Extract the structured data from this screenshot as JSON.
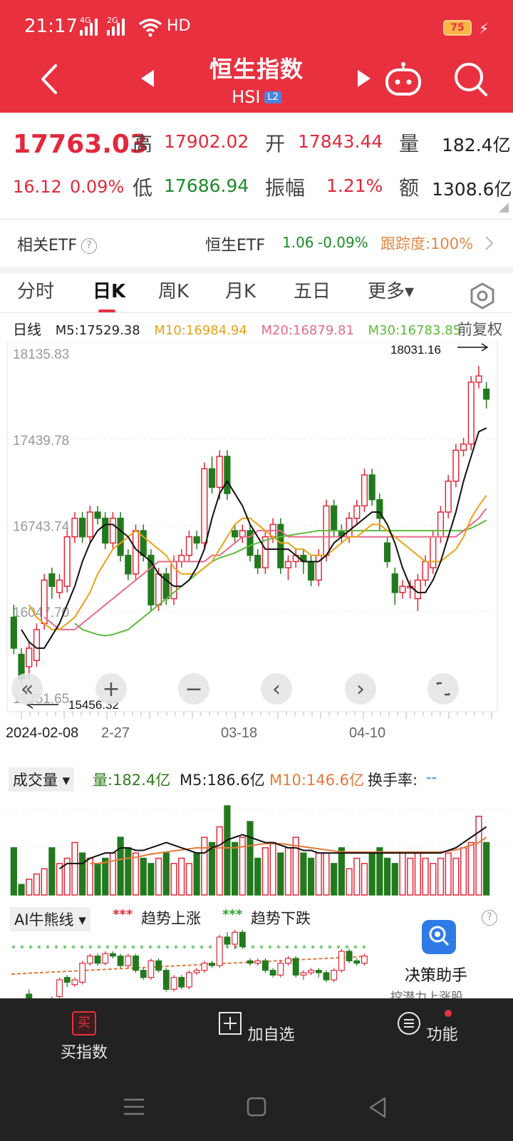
{
  "status": {
    "time": "21:17",
    "sig1": "4G",
    "sig2": "2G",
    "hd": "HD",
    "battery": "75"
  },
  "header": {
    "title": "恒生指数",
    "subtitle": "HSI",
    "badge": "L2"
  },
  "quote": {
    "price": "17763.03",
    "change": "16.12",
    "change_pct": "0.09%",
    "high_label": "高",
    "high": "17902.02",
    "low_label": "低",
    "low": "17686.94",
    "open_label": "开",
    "open": "17843.44",
    "amp_label": "振幅",
    "amp": "1.21%",
    "vol_label": "量",
    "vol": "182.4亿",
    "amt_label": "额",
    "amt": "1308.6亿"
  },
  "etf": {
    "label": "相关ETF",
    "name": "恒生ETF",
    "price": "1.06",
    "pct": "-0.09%",
    "track": "跟踪度:100%"
  },
  "tabs": [
    "分时",
    "日K",
    "周K",
    "月K",
    "五日",
    "更多▾"
  ],
  "ma": {
    "day": "日线",
    "m5": "M5:17529.38",
    "m10": "M10:16984.94",
    "m20": "M20:16879.81",
    "m30": "M30:16783.85",
    "adj": "前复权"
  },
  "volume_panel": {
    "label": "成交量",
    "vol": "量:182.4亿",
    "m5": "M5:186.6亿",
    "m10": "M10:146.6亿",
    "turnover": "换手率:",
    "turnover_val": "--"
  },
  "ai_panel": {
    "label": "AI牛熊线",
    "up": "趋势上涨",
    "down": "趋势下跌",
    "stars": "***"
  },
  "helper": {
    "title": "决策助手",
    "sub": "挖潜力上涨股"
  },
  "nav": {
    "buy": "买指数",
    "buy_icon": "买",
    "add": "加自选",
    "func": "功能"
  },
  "colors": {
    "up": "#e2283a",
    "down": "#237a1e",
    "m5": "#111111",
    "m10": "#e8a21a",
    "m20": "#e76a8a",
    "m30": "#5cbb3a"
  },
  "chart_data": {
    "type": "candlestick",
    "y_ticks": [
      "18135.83",
      "17439.78",
      "16743.74",
      "16047.70",
      "15351.65"
    ],
    "ylim": [
      15351.65,
      18135.83
    ],
    "x_ticks": [
      "2024-02-08",
      "2-27",
      "03-18",
      "04-10"
    ],
    "max_label": "18031.16",
    "min_label": "15456.32",
    "candles": [
      [
        16000,
        15750,
        16100,
        15700
      ],
      [
        15700,
        15500,
        15750,
        15456.32
      ],
      [
        15600,
        15750,
        15800,
        15500
      ],
      [
        15650,
        15900,
        15950,
        15600
      ],
      [
        15950,
        16300,
        16350,
        15900
      ],
      [
        16350,
        16250,
        16400,
        16150
      ],
      [
        16200,
        16300,
        16350,
        16150
      ],
      [
        16250,
        16650,
        16700,
        16200
      ],
      [
        16650,
        16800,
        16850,
        16600
      ],
      [
        16800,
        16650,
        16850,
        16600
      ],
      [
        16650,
        16850,
        16900,
        16600
      ],
      [
        16850,
        16800,
        16900,
        16750
      ],
      [
        16800,
        16600,
        16850,
        16550
      ],
      [
        16600,
        16800,
        16850,
        16550
      ],
      [
        16800,
        16500,
        16850,
        16450
      ],
      [
        16500,
        16350,
        16550,
        16300
      ],
      [
        16350,
        16700,
        16750,
        16300
      ],
      [
        16700,
        16500,
        16750,
        16450
      ],
      [
        16500,
        16100,
        16550,
        16050
      ],
      [
        16100,
        16350,
        16400,
        16050
      ],
      [
        16350,
        16150,
        16400,
        16100
      ],
      [
        16150,
        16450,
        16500,
        16100
      ],
      [
        16450,
        16500,
        16550,
        16400
      ],
      [
        16500,
        16650,
        16700,
        16450
      ],
      [
        16650,
        16600,
        16700,
        16550
      ],
      [
        16600,
        17200,
        17250,
        16550
      ],
      [
        17200,
        17050,
        17300,
        17000
      ],
      [
        17050,
        17300,
        17350,
        16950
      ],
      [
        17300,
        17000,
        17350,
        16950
      ],
      [
        16700,
        16650,
        16750,
        16600
      ],
      [
        16650,
        16700,
        16750,
        16600
      ],
      [
        16700,
        16500,
        16750,
        16450
      ],
      [
        16500,
        16400,
        16550,
        16350
      ],
      [
        16400,
        16650,
        16700,
        16350
      ],
      [
        16650,
        16750,
        16800,
        16600
      ],
      [
        16750,
        16400,
        16800,
        16350
      ],
      [
        16400,
        16450,
        16500,
        16300
      ],
      [
        16450,
        16500,
        16550,
        16400
      ],
      [
        16500,
        16450,
        16550,
        16350
      ],
      [
        16450,
        16300,
        16500,
        16250
      ],
      [
        16300,
        16500,
        16550,
        16250
      ],
      [
        16500,
        16900,
        16950,
        16450
      ],
      [
        16900,
        16700,
        16950,
        16650
      ],
      [
        16700,
        16650,
        16750,
        16600
      ],
      [
        16650,
        16800,
        16850,
        16600
      ],
      [
        16800,
        16900,
        16950,
        16750
      ],
      [
        16900,
        17150,
        17200,
        16850
      ],
      [
        17150,
        16950,
        17200,
        16900
      ],
      [
        16950,
        16800,
        17000,
        16700
      ],
      [
        16600,
        16450,
        16650,
        16400
      ],
      [
        16350,
        16200,
        16400,
        16100
      ],
      [
        16200,
        16250,
        16300,
        16150
      ],
      [
        16250,
        16250,
        16300,
        16150
      ],
      [
        16150,
        16300,
        16350,
        16050
      ],
      [
        16300,
        16450,
        16500,
        16250
      ],
      [
        16400,
        16650,
        16700,
        16350
      ],
      [
        16650,
        16850,
        16900,
        16600
      ],
      [
        16850,
        17100,
        17150,
        16800
      ],
      [
        17100,
        17350,
        17400,
        17050
      ],
      [
        17350,
        17400,
        17450,
        17300
      ],
      [
        17400,
        17900,
        17950,
        17350
      ],
      [
        17900,
        17950,
        18031.16,
        17850
      ],
      [
        17843.44,
        17763.03,
        17902.02,
        17686.94
      ]
    ],
    "ma": {
      "m5": [
        15900,
        15800,
        15750,
        15750,
        15850,
        15950,
        16100,
        16250,
        16450,
        16600,
        16700,
        16750,
        16750,
        16700,
        16650,
        16550,
        16500,
        16450,
        16350,
        16300,
        16250,
        16250,
        16300,
        16400,
        16550,
        16800,
        17000,
        17100,
        17000,
        16900,
        16750,
        16650,
        16550,
        16550,
        16550,
        16550,
        16500,
        16450,
        16450,
        16450,
        16500,
        16600,
        16650,
        16700,
        16750,
        16800,
        16850,
        16850,
        16750,
        16600,
        16400,
        16250,
        16200,
        16200,
        16300,
        16450,
        16650,
        16850,
        17100,
        17300,
        17500,
        17529.38
      ],
      "m10": [
        16100,
        16000,
        15950,
        15900,
        15900,
        15950,
        16000,
        16100,
        16200,
        16350,
        16450,
        16550,
        16600,
        16650,
        16700,
        16650,
        16600,
        16550,
        16500,
        16400,
        16350,
        16350,
        16350,
        16400,
        16450,
        16550,
        16650,
        16750,
        16800,
        16800,
        16750,
        16700,
        16650,
        16600,
        16600,
        16550,
        16550,
        16500,
        16500,
        16500,
        16550,
        16600,
        16650,
        16650,
        16700,
        16750,
        16750,
        16700,
        16650,
        16600,
        16550,
        16500,
        16450,
        16450,
        16450,
        16500,
        16550,
        16650,
        16800,
        16900,
        16984.94
      ],
      "m20": [
        16000,
        15950,
        15900,
        15900,
        15900,
        15950,
        16000,
        16050,
        16100,
        16150,
        16200,
        16250,
        16300,
        16350,
        16400,
        16450,
        16450,
        16450,
        16450,
        16450,
        16450,
        16450,
        16500,
        16500,
        16550,
        16600,
        16650,
        16650,
        16700,
        16700,
        16700,
        16700,
        16650,
        16650,
        16650,
        16650,
        16650,
        16650,
        16650,
        16650,
        16650,
        16650,
        16650,
        16650,
        16650,
        16650,
        16650,
        16650,
        16650,
        16650,
        16650,
        16650,
        16650,
        16650,
        16650,
        16700,
        16750,
        16800,
        16879.81
      ],
      "m30": [
        15950,
        15900,
        15880,
        15860,
        15850,
        15860,
        15880,
        15900,
        15950,
        16000,
        16050,
        16100,
        16150,
        16200,
        16250,
        16300,
        16350,
        16400,
        16450,
        16480,
        16500,
        16520,
        16550,
        16580,
        16600,
        16620,
        16640,
        16650,
        16660,
        16670,
        16680,
        16690,
        16700,
        16700,
        16700,
        16700,
        16700,
        16700,
        16700,
        16700,
        16700,
        16700,
        16700,
        16700,
        16700,
        16700,
        16700,
        16700,
        16700,
        16700,
        16700,
        16700,
        16720,
        16750,
        16783.85
      ]
    },
    "volume": [
      90,
      20,
      30,
      40,
      50,
      90,
      60,
      70,
      100,
      80,
      70,
      60,
      70,
      80,
      110,
      90,
      80,
      70,
      60,
      70,
      80,
      60,
      70,
      60,
      80,
      110,
      100,
      130,
      170,
      100,
      110,
      140,
      70,
      90,
      100,
      80,
      90,
      110,
      80,
      70,
      80,
      80,
      60,
      90,
      50,
      70,
      60,
      80,
      90,
      70,
      60,
      80,
      70,
      80,
      70,
      60,
      70,
      80,
      70,
      90,
      100,
      150,
      100
    ],
    "vol_ma5": [
      50,
      60,
      60,
      60,
      70,
      75,
      80,
      80,
      90,
      90,
      85,
      85,
      90,
      95,
      100,
      95,
      90,
      85,
      80,
      80,
      90,
      95,
      105,
      110,
      115,
      110,
      105,
      100,
      100,
      95,
      90,
      90,
      85,
      85,
      80,
      80,
      80,
      80,
      80,
      80,
      80,
      80,
      80,
      80,
      80,
      80,
      80,
      80,
      80,
      80,
      80,
      85,
      90,
      100,
      110,
      120,
      130
    ],
    "vol_ma10": [
      60,
      60,
      62,
      65,
      68,
      70,
      72,
      75,
      78,
      80,
      82,
      84,
      86,
      88,
      90,
      90,
      90,
      90,
      90,
      90,
      92,
      94,
      96,
      98,
      98,
      98,
      96,
      94,
      92,
      90,
      88,
      86,
      84,
      82,
      82,
      82,
      82,
      82,
      82,
      82,
      82,
      82,
      82,
      82,
      82,
      82,
      82,
      84,
      86,
      90,
      95,
      100,
      110
    ]
  }
}
